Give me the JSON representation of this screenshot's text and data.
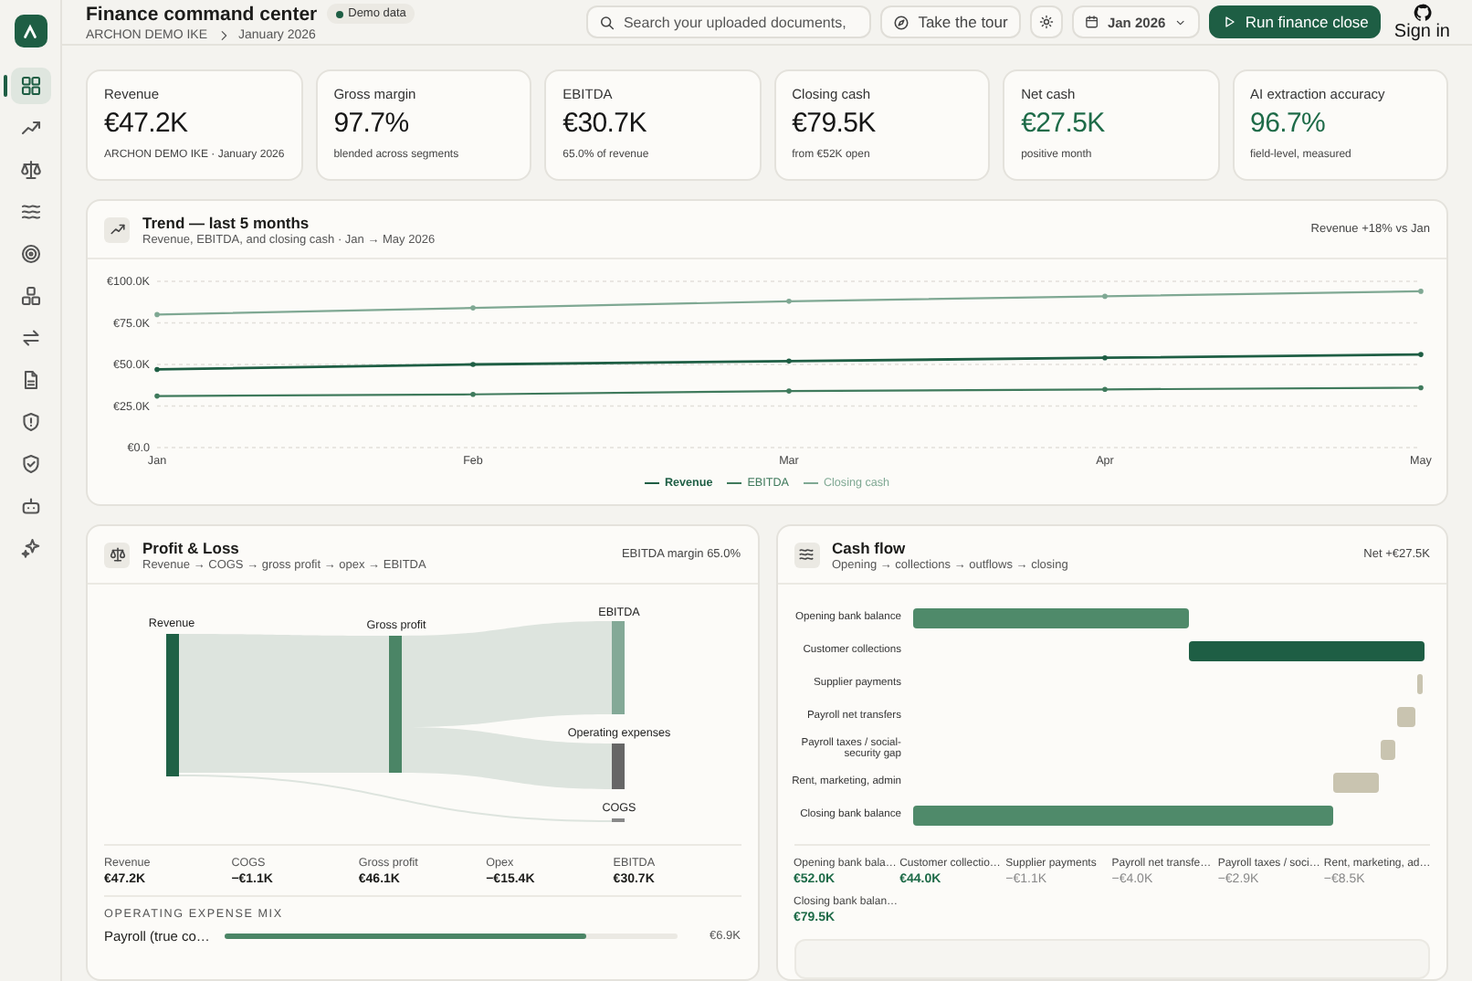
{
  "sidebar": {
    "items": [
      {
        "selected": true
      },
      {
        "selected": false
      },
      {
        "selected": false
      },
      {
        "selected": false
      },
      {
        "selected": false
      },
      {
        "selected": false
      },
      {
        "selected": false
      },
      {
        "selected": false
      },
      {
        "selected": false
      },
      {
        "selected": false
      },
      {
        "selected": false
      },
      {
        "selected": false
      }
    ]
  },
  "header": {
    "title": "Finance command center",
    "badge": "Demo data",
    "breadcrumb": [
      "ARCHON DEMO IKE",
      "January 2026"
    ],
    "search": {
      "placeholder": "Search your uploaded documents,"
    },
    "tour_button": "Take the tour",
    "period": "Jan 2026",
    "run_button": "Run finance close",
    "sign_in": "Sign in"
  },
  "kpis": [
    {
      "label": "Revenue",
      "value": "€47.2K",
      "note": "ARCHON DEMO IKE · January 2026",
      "positive": false
    },
    {
      "label": "Gross margin",
      "value": "97.7%",
      "note": "blended across segments",
      "positive": false
    },
    {
      "label": "EBITDA",
      "value": "€30.7K",
      "note": "65.0% of revenue",
      "positive": false
    },
    {
      "label": "Closing cash",
      "value": "€79.5K",
      "note": "from €52K open",
      "positive": false
    },
    {
      "label": "Net cash",
      "value": "€27.5K",
      "note": "positive month",
      "positive": true
    },
    {
      "label": "AI extraction accuracy",
      "value": "96.7%",
      "note": "field-level, measured",
      "positive": true
    }
  ],
  "trend": {
    "title": "Trend — last 5 months",
    "subtitle": "Revenue, EBITDA, and closing cash · Jan → May 2026",
    "summary": "Revenue +18% vs Jan",
    "chart_data": {
      "type": "line",
      "categories": [
        "Jan",
        "Feb",
        "Mar",
        "Apr",
        "May"
      ],
      "series": [
        {
          "name": "Revenue",
          "color": "#1e5e44",
          "values": [
            47,
            50,
            52,
            54,
            56
          ]
        },
        {
          "name": "EBITDA",
          "color": "#3f7a5c",
          "values": [
            31,
            32,
            34,
            35,
            36
          ]
        },
        {
          "name": "Closing cash",
          "color": "#7fa893",
          "values": [
            80,
            84,
            88,
            91,
            94
          ]
        }
      ],
      "grid": true,
      "legend": true,
      "ylim": [
        0,
        100
      ],
      "yticks": [
        {
          "value": 0,
          "label": "€0.0"
        },
        {
          "value": 25,
          "label": "€25.0K"
        },
        {
          "value": 50,
          "label": "€50.0K"
        },
        {
          "value": 75,
          "label": "€75.0K"
        },
        {
          "value": 100,
          "label": "€100.0K"
        }
      ]
    }
  },
  "pnl": {
    "title": "Profit & Loss",
    "subtitle": "Revenue → COGS → gross profit → opex → EBITDA",
    "summary": "EBITDA margin 65.0%",
    "sankey_labels": [
      "Revenue",
      "Gross profit",
      "EBITDA",
      "Operating expenses",
      "COGS"
    ],
    "totals": [
      {
        "label": "Revenue",
        "value": "€47.2K"
      },
      {
        "label": "COGS",
        "value": "−€1.1K"
      },
      {
        "label": "Gross profit",
        "value": "€46.1K"
      },
      {
        "label": "Opex",
        "value": "−€15.4K"
      },
      {
        "label": "EBITDA",
        "value": "€30.7K"
      }
    ],
    "expense_mix_title": "OPERATING EXPENSE MIX",
    "expense_mix": [
      {
        "label": "Payroll (true co…",
        "level": 0.8,
        "value": "€6.9K"
      }
    ]
  },
  "cashflow": {
    "title": "Cash flow",
    "subtitle": "Opening → collections → outflows → closing",
    "summary": "Net +€27.5K",
    "steps": [
      "Opening bank balance",
      "Customer collections",
      "Supplier payments",
      "Payroll net transfers",
      "Payroll taxes / social-security gap",
      "Rent, marketing, admin",
      "Closing bank balance"
    ],
    "totals": [
      {
        "label": "Opening bank bala…",
        "value": "€52.0K",
        "positive": true
      },
      {
        "label": "Customer collectio…",
        "value": "€44.0K",
        "positive": true
      },
      {
        "label": "Supplier payments",
        "value": "−€1.1K",
        "positive": false
      },
      {
        "label": "Payroll net transfe…",
        "value": "−€4.0K",
        "positive": false
      },
      {
        "label": "Payroll taxes / soci…",
        "value": "−€2.9K",
        "positive": false
      },
      {
        "label": "Rent, marketing, ad…",
        "value": "−€8.5K",
        "positive": false
      },
      {
        "label": "Closing bank balan…",
        "value": "€79.5K",
        "positive": true
      }
    ]
  }
}
